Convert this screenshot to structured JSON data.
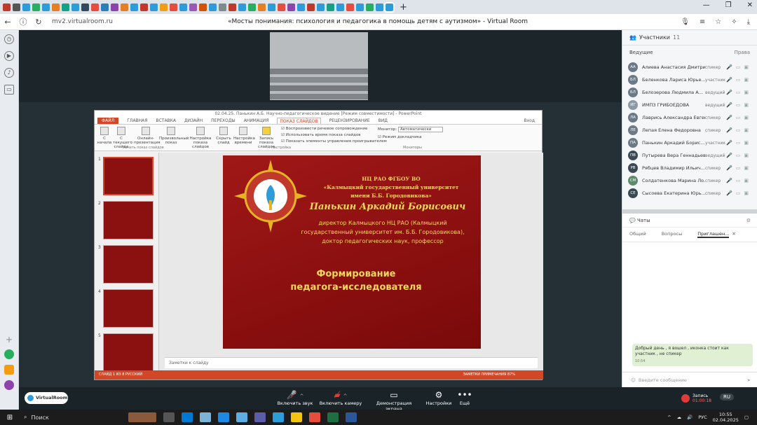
{
  "browser": {
    "url": "mv2.virtualroom.ru",
    "page_title": "«Мосты понимания: психология и педагогика в помощь детям с аутизмом» - Virtual Room"
  },
  "ppt": {
    "doc_title": "02.04.25. Панькин А.Б. Научно-педагогическое видение [Режим совместимости] - PowerPoint",
    "tabs": [
      "ФАЙЛ",
      "ГЛАВНАЯ",
      "ВСТАВКА",
      "ДИЗАЙН",
      "ПЕРЕХОДЫ",
      "АНИМАЦИЯ",
      "ПОКАЗ СЛАЙДОВ",
      "РЕЦЕНЗИРОВАНИЕ",
      "ВИД"
    ],
    "signin": "Вход",
    "ribbon_buttons": [
      "С начала",
      "С текущего слайда",
      "Онлайн-презентация",
      "Произвольный показ",
      "Настройка показа слайдов",
      "Скрыть слайд",
      "Настройка времени",
      "Запись показа слайдов"
    ],
    "checks": [
      "Воспроизвести речевое сопровождение",
      "Использовать время показа слайдов",
      "Показать элементы управления проигрывателем"
    ],
    "monitor_label": "Монитор:",
    "monitor_value": "Автоматически",
    "presenter_view": "Режим докладчика",
    "groups": [
      "Начать показ слайдов",
      "Настройка",
      "Мониторы"
    ],
    "slide_numbers": [
      "1",
      "2",
      "3",
      "4",
      "5"
    ],
    "slide": {
      "org": [
        "НЦ РАО ФГБОУ ВО",
        "«Калмыцкий государственный университет",
        "имени Б.Б. Городовикова»"
      ],
      "name": "Панькин Аркадий Борисович",
      "position": [
        "директор Калмыцкого НЦ РАО (Калмыцкий",
        "государственный университет им. Б.Б. Городовикова),",
        "доктор педагогических наук, профессор"
      ],
      "topic": [
        "Формирование",
        "педагога-исследователя"
      ]
    },
    "notes_placeholder": "Заметки к слайду",
    "status_left": "СЛАЙД 1 ИЗ 8    РУССКИЙ",
    "status_right": "ЗАМЕТКИ    ПРИМЕЧАНИЯ    87%"
  },
  "participants": {
    "title": "Участники",
    "count": "11",
    "section": "Ведущие",
    "rights": "Права",
    "list": [
      {
        "initials": "АА",
        "name": "Алиева Анастасия Дмитри...",
        "role": "спикер",
        "color": "#6b7a86"
      },
      {
        "initials": "БЛ",
        "name": "Беленкова Лариса Юрье...",
        "role": "участник",
        "color": "#6b7a86"
      },
      {
        "initials": "БЛ",
        "name": "Белозерова Людмила А...",
        "role": "ведущий",
        "color": "#6b7a86"
      },
      {
        "initials": "ИГ",
        "name": "ИМПЗ ГРИБОЕДОВА",
        "role": "ведущий",
        "color": "#8a9aa5"
      },
      {
        "initials": "ЛА",
        "name": "Лаврись Александра Евген...",
        "role": "спикер",
        "color": "#6b7a86"
      },
      {
        "initials": "ЛЕ",
        "name": "Лепая Елена Федоровна",
        "role": "спикер",
        "color": "#6b7a86"
      },
      {
        "initials": "ПА",
        "name": "Панькин Аркадий Борис...",
        "role": "участник",
        "color": "#6b7a86"
      },
      {
        "initials": "ПВ",
        "name": "Путырева Вера Геннадьевна",
        "role": "ведущий",
        "color": "#3a4a55"
      },
      {
        "initials": "РВ",
        "name": "Рябцев Владимир Ильич...",
        "role": "спикер",
        "color": "#3a4a55"
      },
      {
        "initials": "СМ",
        "name": "Солдатенкова Марина Ло...",
        "role": "спикер",
        "color": "#5e8c6a"
      },
      {
        "initials": "СЕ",
        "name": "Сысоева Екатерина Юрь...",
        "role": "спикер",
        "color": "#3a4a55"
      }
    ]
  },
  "chat": {
    "title": "Чаты",
    "tabs": [
      "Общий",
      "Вопросы",
      "Приглашен..."
    ],
    "message": "Добрый день , я вошел , иконка стоит как участник , не спикер",
    "message_time": "10:54",
    "input_placeholder": "Введите сообщение"
  },
  "toolbar": {
    "brand": "VirtualRoom",
    "mic": "Включить звук",
    "camera": "Включить камеру",
    "screen": "Демонстрация экрана",
    "settings": "Настройки",
    "more": "Ещё",
    "rec_label": "Запись",
    "rec_time": "01:00:18",
    "lang": "RU"
  },
  "taskbar": {
    "search": "Поиск",
    "lang": "РУС",
    "time": "10:55",
    "date": "02.04.2025"
  }
}
